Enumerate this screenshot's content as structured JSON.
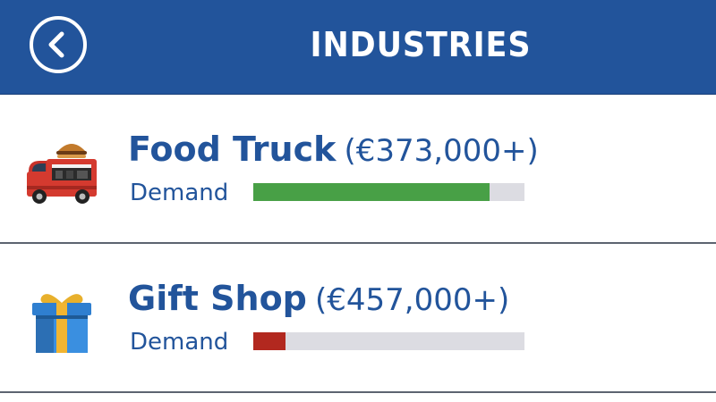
{
  "header": {
    "title": "INDUSTRIES",
    "back_icon": "chevron-left-icon",
    "background": "#22549b"
  },
  "industries": [
    {
      "name": "Food Truck",
      "price": "(€373,000+)",
      "demand_label": "Demand",
      "demand_fraction": 0.87,
      "demand_color": "#48a046",
      "icon": "food-truck-icon"
    },
    {
      "name": "Gift Shop",
      "price": "(€457,000+)",
      "demand_label": "Demand",
      "demand_fraction": 0.12,
      "demand_color": "#b2281f",
      "icon": "gift-box-icon"
    }
  ],
  "colors": {
    "accent": "#22549b",
    "divider": "#5c6470",
    "track": "#dcdce2"
  }
}
